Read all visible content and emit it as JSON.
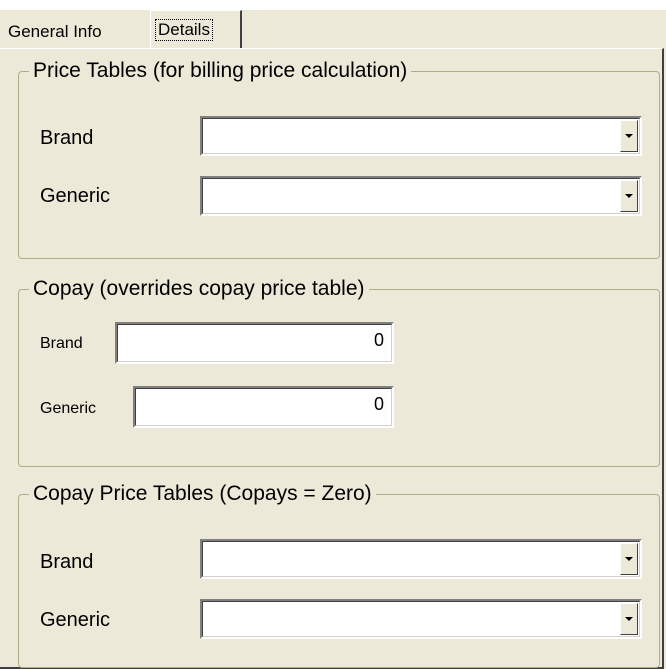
{
  "tabs": [
    {
      "label": "General Info",
      "active": false
    },
    {
      "label": "Details",
      "active": true
    }
  ],
  "price_tables": {
    "title": "Price Tables (for billing price calculation)",
    "brand_label": "Brand",
    "generic_label": "Generic",
    "brand_value": "",
    "generic_value": ""
  },
  "copay": {
    "title": "Copay (overrides copay price table)",
    "brand_label": "Brand",
    "generic_label": "Generic",
    "brand_value": "0",
    "generic_value": "0"
  },
  "copay_price_tables": {
    "title": "Copay Price Tables (Copays = Zero)",
    "brand_label": "Brand",
    "generic_label": "Generic",
    "brand_value": "",
    "generic_value": ""
  },
  "icons": [
    "dropdown-arrow-icon"
  ],
  "colors": {
    "panel_bg": "#ece9d8",
    "field_bg": "#ffffff"
  }
}
